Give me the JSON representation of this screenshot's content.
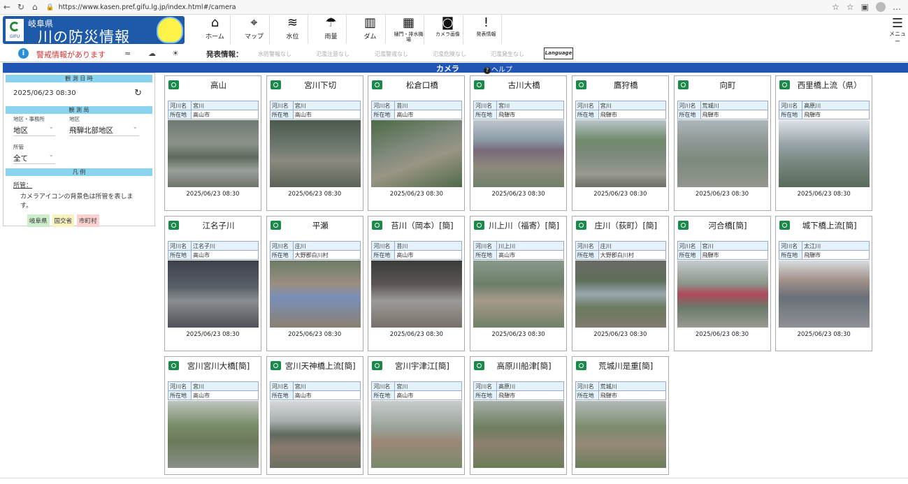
{
  "browser": {
    "url": "https://www.kasen.pref.gifu.lg.jp/index.html#/camera"
  },
  "header": {
    "logo_text": "GIFU",
    "pref": "岐阜県",
    "title": "川の防災情報",
    "nav": [
      {
        "label": "ホーム",
        "icon": "home-icon"
      },
      {
        "label": "マップ",
        "icon": "map-icon"
      },
      {
        "label": "水位",
        "icon": "water-level-icon"
      },
      {
        "label": "雨量",
        "icon": "rain-icon"
      },
      {
        "label": "ダム",
        "icon": "dam-icon"
      },
      {
        "label": "樋門・排水機場",
        "icon": "sluice-icon"
      },
      {
        "label": "カメラ画像",
        "icon": "camera-icon"
      },
      {
        "label": "発表情報",
        "icon": "alert-doc-icon"
      }
    ],
    "menu_label": "メニュー"
  },
  "subbar": {
    "alert_text": "警戒情報があります",
    "announce_label": "発表情報：",
    "statuses": [
      "水防警報なし",
      "氾濫注意なし",
      "氾濫警戒なし",
      "氾濫危険なし",
      "氾濫発生なし"
    ],
    "language": "Language"
  },
  "bar": {
    "title": "カメラ",
    "help": "ヘルプ"
  },
  "side": {
    "obs_time_header": "観 測 日 時",
    "obs_time": "2025/06/23 08:30",
    "station_header": "観 測 局",
    "area_office_label": "地区・事務所",
    "area_office_value": "地区",
    "district_label": "地区",
    "district_value": "飛騨北部地区",
    "jurisdiction_label": "所管",
    "jurisdiction_value": "全て",
    "legend_header": "凡 例",
    "legend_link": "所管：",
    "legend_note": "カメラアイコンの背景色は所管を表します。",
    "legend_items": [
      {
        "label": "岐阜県",
        "color": "#cdeecb"
      },
      {
        "label": "国交省",
        "color": "#f7f3c0"
      },
      {
        "label": "市町村",
        "color": "#fbd2d2"
      }
    ]
  },
  "table_keys": {
    "river": "河川名",
    "location": "所在地"
  },
  "cameras": [
    {
      "name": "高山",
      "river": "宮川",
      "location": "高山市",
      "time": "2025/06/23 08:30"
    },
    {
      "name": "宮川下切",
      "river": "宮川",
      "location": "高山市",
      "time": "2025/06/23 08:30"
    },
    {
      "name": "松倉口橋",
      "river": "苔川",
      "location": "高山市",
      "time": "2025/06/23 08:30"
    },
    {
      "name": "古川大橋",
      "river": "宮川",
      "location": "飛騨市",
      "time": "2025/06/23 08:30"
    },
    {
      "name": "鷹狩橋",
      "river": "宮川",
      "location": "飛騨市",
      "time": "2025/06/23 08:30"
    },
    {
      "name": "向町",
      "river": "荒城川",
      "location": "飛騨市",
      "time": "2025/06/23 08:30"
    },
    {
      "name": "西里橋上流（県）",
      "river": "高原川",
      "location": "飛騨市",
      "time": "2025/06/23 08:30"
    },
    {
      "name": "江名子川",
      "river": "江名子川",
      "location": "高山市",
      "time": "2025/06/23 08:30"
    },
    {
      "name": "平瀬",
      "river": "庄川",
      "location": "大野郡白川村",
      "time": "2025/06/23 08:30"
    },
    {
      "name": "苔川（岡本）[簡]",
      "river": "苔川",
      "location": "高山市",
      "time": "2025/06/23 08:30"
    },
    {
      "name": "川上川（福寄）[簡]",
      "river": "川上川",
      "location": "高山市",
      "time": "2025/06/23 08:30"
    },
    {
      "name": "庄川（荻町）[簡]",
      "river": "庄川",
      "location": "大野郡白川村",
      "time": "2025/06/23 08:30"
    },
    {
      "name": "河合橋[簡]",
      "river": "宮川",
      "location": "飛騨市",
      "time": "2025/06/23 08:30"
    },
    {
      "name": "城下橋上流[簡]",
      "river": "太江川",
      "location": "飛騨市",
      "time": "2025/06/23 08:30"
    },
    {
      "name": "宮川宮川大橋[簡]",
      "river": "宮川",
      "location": "高山市",
      "time": ""
    },
    {
      "name": "宮川天神橋上流[簡]",
      "river": "宮川",
      "location": "高山市",
      "time": ""
    },
    {
      "name": "宮川宇津江[簡]",
      "river": "宮川",
      "location": "高山市",
      "time": ""
    },
    {
      "name": "高原川船津[簡]",
      "river": "高原川",
      "location": "飛騨市",
      "time": ""
    },
    {
      "name": "荒城川是重[簡]",
      "river": "荒城川",
      "location": "飛騨市",
      "time": ""
    }
  ]
}
